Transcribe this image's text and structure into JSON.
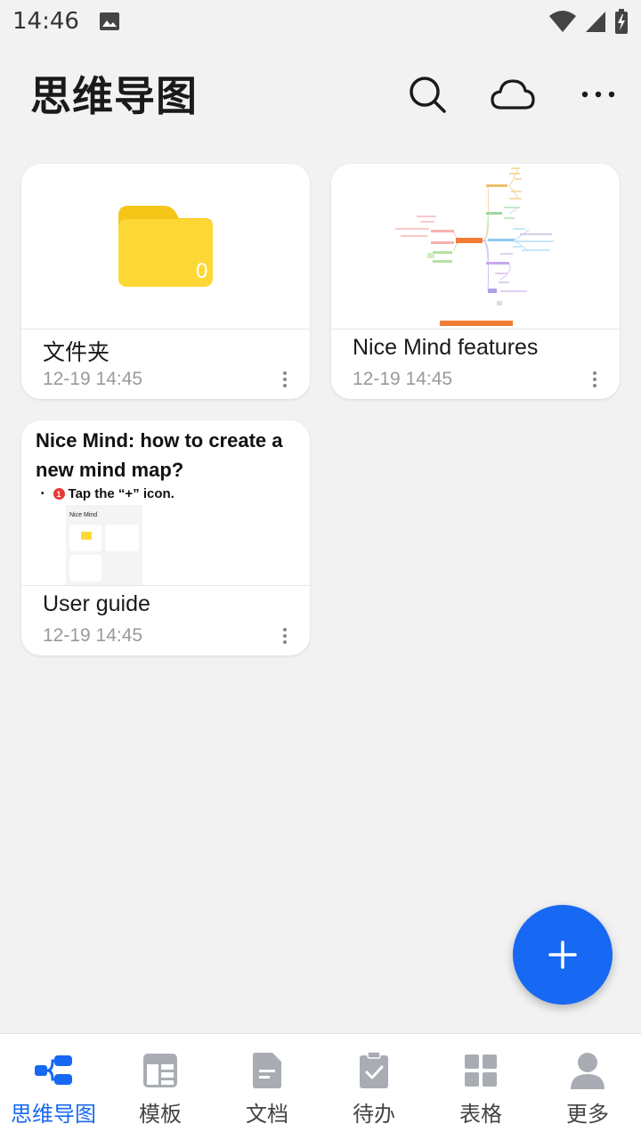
{
  "status_bar": {
    "time": "14:46"
  },
  "header": {
    "title": "思维导图"
  },
  "colors": {
    "accent": "#1768f2",
    "folder": "#fdd835",
    "icon_gray": "#a9adb3"
  },
  "items": [
    {
      "name": "文件夹",
      "date": "12-19 14:45",
      "type": "folder",
      "count": "0"
    },
    {
      "name": "Nice Mind features",
      "date": "12-19 14:45",
      "type": "mindmap"
    },
    {
      "name": "User guide",
      "date": "12-19 14:45",
      "type": "document",
      "preview_title": "Nice Mind: how to create a new mind map?",
      "preview_step_number": "1",
      "preview_step": "Tap the “+” icon.",
      "preview_app_name": "Nice Mind"
    }
  ],
  "bottom_nav": [
    {
      "label": "思维导图",
      "icon": "mindmap-icon",
      "active": true
    },
    {
      "label": "模板",
      "icon": "template-icon"
    },
    {
      "label": "文档",
      "icon": "document-icon"
    },
    {
      "label": "待办",
      "icon": "todo-icon"
    },
    {
      "label": "表格",
      "icon": "table-icon"
    },
    {
      "label": "更多",
      "icon": "person-icon"
    }
  ]
}
